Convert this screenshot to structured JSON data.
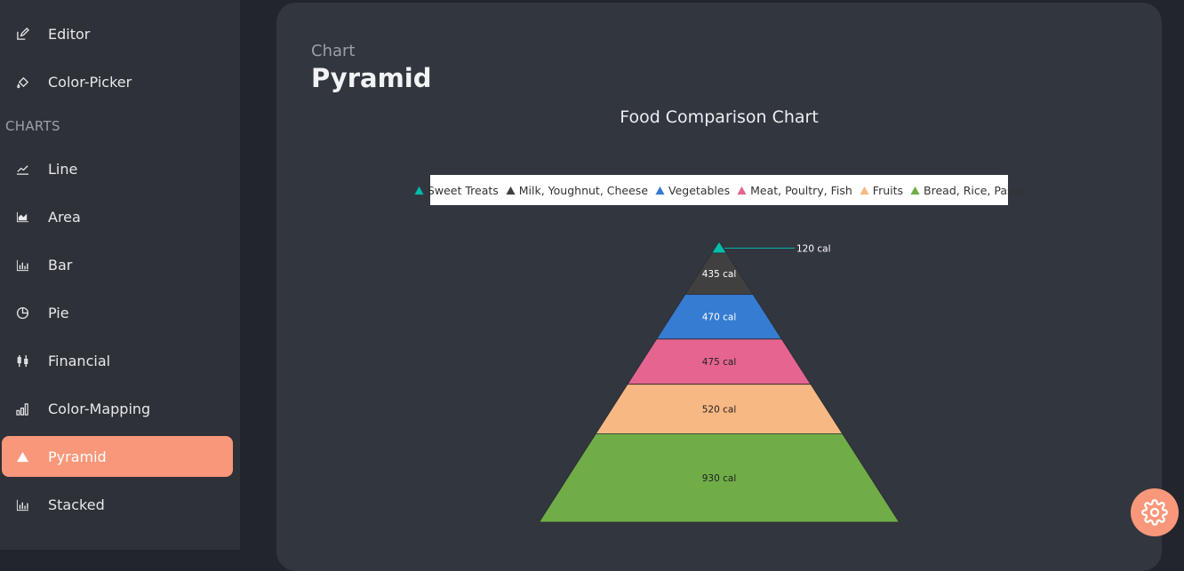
{
  "sidebar": {
    "top_items": [
      {
        "label": "Editor",
        "icon": "edit-icon"
      },
      {
        "label": "Color-Picker",
        "icon": "paint-bucket-icon"
      }
    ],
    "section_label": "CHARTS",
    "items": [
      {
        "label": "Line",
        "icon": "line-chart-icon"
      },
      {
        "label": "Area",
        "icon": "area-chart-icon"
      },
      {
        "label": "Bar",
        "icon": "bar-chart-icon"
      },
      {
        "label": "Pie",
        "icon": "pie-chart-icon"
      },
      {
        "label": "Financial",
        "icon": "candlestick-icon"
      },
      {
        "label": "Color-Mapping",
        "icon": "signal-bars-icon"
      },
      {
        "label": "Pyramid",
        "icon": "triangle-icon",
        "active": true
      },
      {
        "label": "Stacked",
        "icon": "bar-chart-icon"
      }
    ],
    "active_color": "#f9977a"
  },
  "header": {
    "breadcrumb": "Chart",
    "title": "Pyramid"
  },
  "chart_data": {
    "type": "pyramid",
    "title": "Food Comparison Chart",
    "legend_position": "top",
    "categories": [
      "Sweet Treats",
      "Milk, Youghnut, Cheese",
      "Vegetables",
      "Meat, Poultry, Fish",
      "Fruits",
      "Bread, Rice, Pasta"
    ],
    "values": [
      120,
      435,
      470,
      475,
      520,
      930
    ],
    "data_labels": [
      "120 cal",
      "435 cal",
      "470 cal",
      "475 cal",
      "520 cal",
      "930 cal"
    ],
    "colors": [
      "#00bdae",
      "#404041",
      "#357cd2",
      "#e56590",
      "#f8b883",
      "#70ad47"
    ]
  },
  "settings_button": {
    "icon": "gear-icon"
  }
}
